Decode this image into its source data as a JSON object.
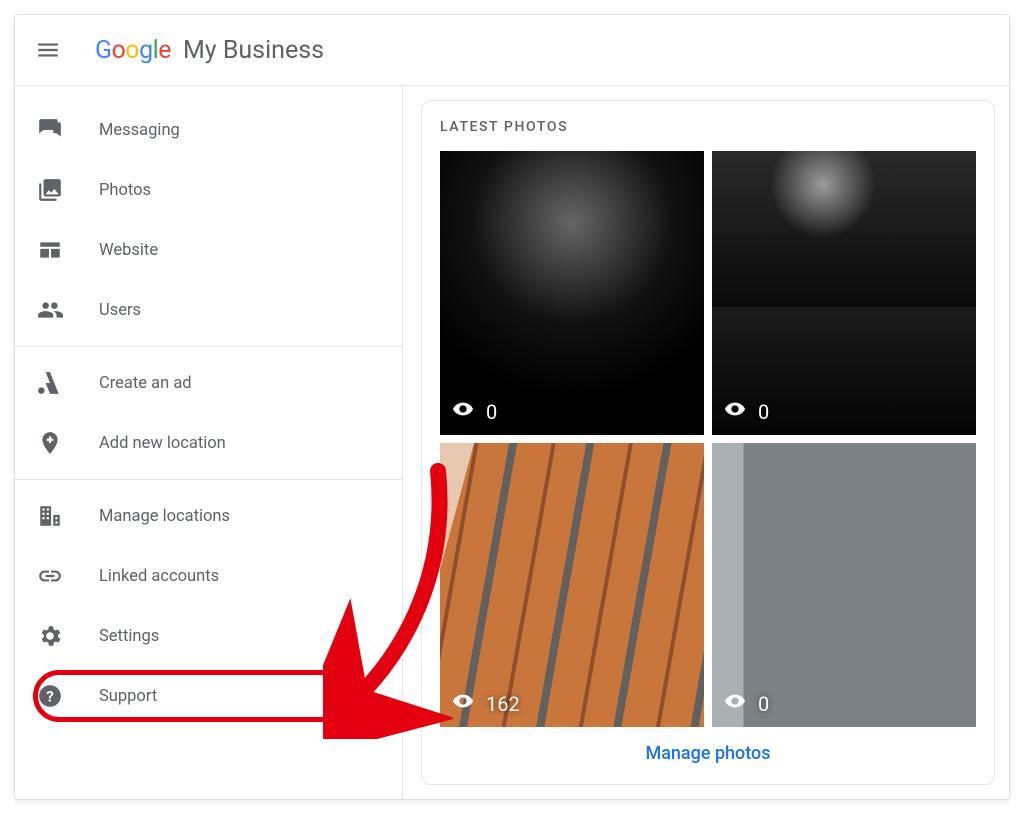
{
  "header": {
    "brand_primary": "Google",
    "brand_secondary": "My Business"
  },
  "sidebar": {
    "groups": [
      {
        "items": [
          {
            "icon": "chat-icon",
            "label": "Messaging"
          },
          {
            "icon": "photo-icon",
            "label": "Photos"
          },
          {
            "icon": "website-icon",
            "label": "Website"
          },
          {
            "icon": "users-icon",
            "label": "Users"
          }
        ]
      },
      {
        "items": [
          {
            "icon": "ads-icon",
            "label": "Create an ad"
          },
          {
            "icon": "add-location-icon",
            "label": "Add new location"
          }
        ]
      },
      {
        "items": [
          {
            "icon": "buildings-icon",
            "label": "Manage locations"
          },
          {
            "icon": "link-icon",
            "label": "Linked accounts"
          },
          {
            "icon": "gear-icon",
            "label": "Settings"
          },
          {
            "icon": "help-icon",
            "label": "Support",
            "highlight": true
          }
        ]
      }
    ]
  },
  "content": {
    "card_title": "LATEST PHOTOS",
    "photos": [
      {
        "views": "0"
      },
      {
        "views": "0"
      },
      {
        "views": "162"
      },
      {
        "views": "0"
      }
    ],
    "manage_link": "Manage photos"
  },
  "annotation": {
    "red_arrow_points_to": "Support"
  }
}
